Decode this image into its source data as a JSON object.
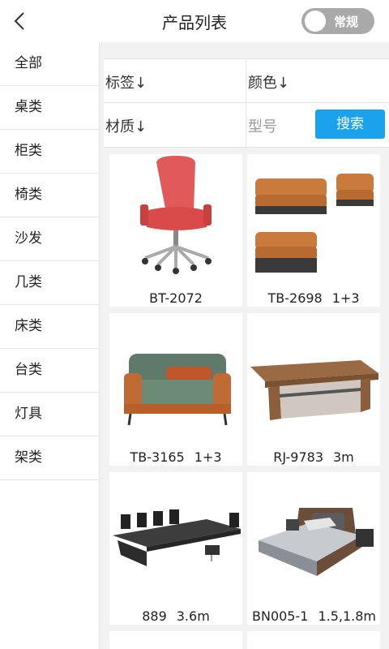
{
  "header": {
    "title": "产品列表",
    "toggle_label": "常规"
  },
  "sidebar": {
    "items": [
      "全部",
      "桌类",
      "柜类",
      "椅类",
      "沙发",
      "几类",
      "床类",
      "台类",
      "灯具",
      "架类"
    ]
  },
  "filters": {
    "tag": "标签↓",
    "color": "颜色↓",
    "material": "材质↓",
    "model_placeholder": "型号",
    "search": "搜索"
  },
  "products": [
    {
      "code": "BT-2072",
      "size": ""
    },
    {
      "code": "TB-2698",
      "size": "1+3"
    },
    {
      "code": "TB-3165",
      "size": "1+3"
    },
    {
      "code": "RJ-9783",
      "size": "3m"
    },
    {
      "code": "889",
      "size": "3.6m"
    },
    {
      "code": "BN005-1",
      "size": "1.5,1.8m"
    }
  ]
}
